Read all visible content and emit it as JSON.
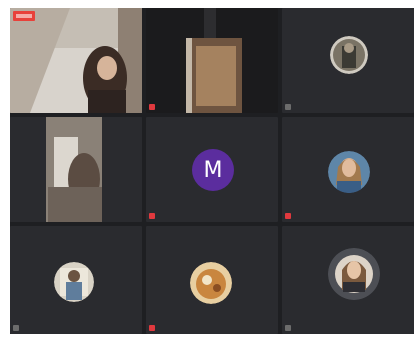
{
  "meeting": {
    "letter_avatar": "M"
  },
  "colors": {
    "background": "#1e1f22",
    "tile": "#2a2b2f",
    "mic_muted": "#e0393e",
    "avatar_purple": "#5b2d9e"
  },
  "icons": {
    "mic": "mic-muted-icon",
    "record": "recording-icon"
  }
}
